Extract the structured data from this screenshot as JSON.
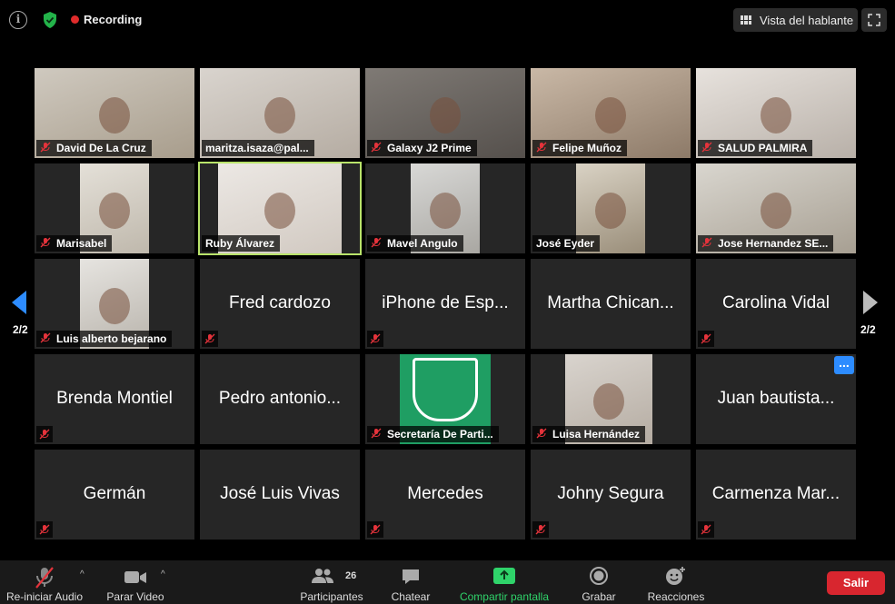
{
  "topbar": {
    "recording_label": "Recording",
    "speaker_view_label": "Vista del hablante"
  },
  "pagination": {
    "left_page": "2/2",
    "right_page": "2/2"
  },
  "participants": [
    {
      "name": "David De La Cruz",
      "video": true,
      "muted": true
    },
    {
      "name": "maritza.isaza@pal...",
      "video": true,
      "muted": false
    },
    {
      "name": "Galaxy J2 Prime",
      "video": true,
      "muted": true
    },
    {
      "name": "Felipe Muñoz",
      "video": true,
      "muted": true
    },
    {
      "name": "SALUD PALMIRA",
      "video": true,
      "muted": true
    },
    {
      "name": "Marisabel",
      "video": true,
      "muted": true
    },
    {
      "name": "Ruby Álvarez",
      "video": true,
      "muted": false,
      "active": true
    },
    {
      "name": "Mavel Angulo",
      "video": true,
      "muted": true
    },
    {
      "name": "José Eyder",
      "video": true,
      "muted": false
    },
    {
      "name": "Jose Hernandez SE...",
      "video": true,
      "muted": true
    },
    {
      "name": "Luis alberto bejarano",
      "video": true,
      "muted": true
    },
    {
      "name": "Fred cardozo",
      "video": false,
      "muted": true
    },
    {
      "name": "iPhone de Esp...",
      "video": false,
      "muted": true
    },
    {
      "name": "Martha Chican...",
      "video": false,
      "muted": false
    },
    {
      "name": "Carolina Vidal",
      "video": false,
      "muted": true
    },
    {
      "name": "Brenda Montiel",
      "video": false,
      "muted": true
    },
    {
      "name": "Pedro antonio...",
      "video": false,
      "muted": false
    },
    {
      "name": "Secretaría De Parti...",
      "video": true,
      "muted": true
    },
    {
      "name": "Luisa Hernández",
      "video": true,
      "muted": true
    },
    {
      "name": "Juan bautista...",
      "video": false,
      "muted": false,
      "more": "..."
    },
    {
      "name": "Germán",
      "video": false,
      "muted": true
    },
    {
      "name": "José Luis  Vivas",
      "video": false,
      "muted": false
    },
    {
      "name": "Mercedes",
      "video": false,
      "muted": true
    },
    {
      "name": "Johny Segura",
      "video": false,
      "muted": true
    },
    {
      "name": "Carmenza Mar...",
      "video": false,
      "muted": true
    }
  ],
  "toolbar": {
    "audio_label": "Re-iniciar Audio",
    "video_label": "Parar Video",
    "participants_label": "Participantes",
    "participants_count": "26",
    "chat_label": "Chatear",
    "share_label": "Compartir pantalla",
    "record_label": "Grabar",
    "reactions_label": "Reacciones",
    "leave_label": "Salir"
  },
  "colors": {
    "share_green": "#2fd36a",
    "leave_red": "#d8262f",
    "active_speaker": "#b9e36a",
    "recording_red": "#e02b2b",
    "more_blue": "#2d8cff"
  }
}
